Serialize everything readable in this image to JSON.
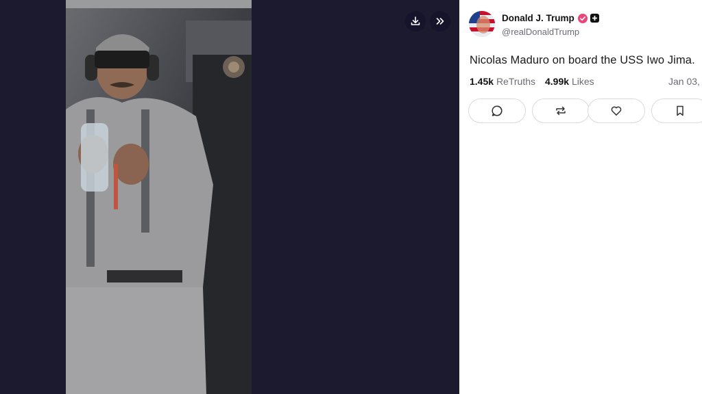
{
  "media": {
    "download_icon": "download-icon",
    "expand_icon": "double-chevron-right-icon"
  },
  "post": {
    "display_name": "Donald J. Trump",
    "handle": "@realDonaldTrump",
    "text": "Nicolas Maduro on board the USS Iwo Jima.",
    "retruths_count": "1.45k",
    "retruths_label": "ReTruths",
    "likes_count": "4.99k",
    "likes_label": "Likes",
    "date": "Jan 03,"
  },
  "actions": [
    {
      "name": "reply",
      "icon": "comment-icon"
    },
    {
      "name": "retruth",
      "icon": "repost-icon"
    },
    {
      "name": "like",
      "icon": "heart-icon"
    },
    {
      "name": "bookmark",
      "icon": "bookmark-icon"
    }
  ],
  "colors": {
    "viewer_background": "#1b1a2e",
    "verified_badge": "#e8477a",
    "text_primary": "#111111",
    "text_secondary": "#6b6b76"
  }
}
